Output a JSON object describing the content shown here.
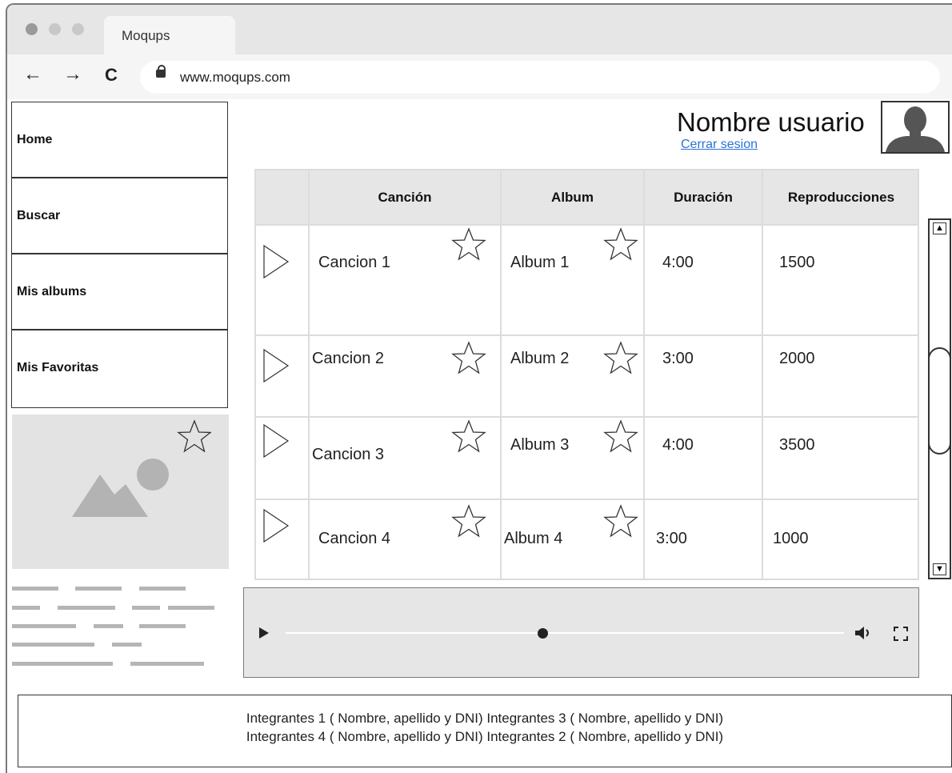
{
  "browser": {
    "tab_title": "Moqups",
    "url": "www.moqups.com",
    "back_icon": "←",
    "forward_icon": "→",
    "reload_icon": "C"
  },
  "sidebar": {
    "items": [
      {
        "label": "Home"
      },
      {
        "label": "Buscar"
      },
      {
        "label": "Mis albums"
      },
      {
        "label": "Mis Favoritas"
      }
    ]
  },
  "header": {
    "username": "Nombre usuario",
    "logout": "Cerrar sesion"
  },
  "table": {
    "columns": [
      "Canción",
      "Album",
      "Duración",
      "Reproducciones"
    ],
    "rows": [
      {
        "song": "Cancion 1",
        "album": "Album 1",
        "duration": "4:00",
        "plays": "1500"
      },
      {
        "song": "Cancion 2",
        "album": "Album 2",
        "duration": "3:00",
        "plays": "2000"
      },
      {
        "song": "Cancion 3",
        "album": "Album 3",
        "duration": "4:00",
        "plays": "3500"
      },
      {
        "song": "Cancion 4",
        "album": "Album 4",
        "duration": "3:00",
        "plays": "1000"
      }
    ]
  },
  "player": {
    "progress": 0.46
  },
  "footer": {
    "line1": "Integrantes 1 ( Nombre, apellido y DNI) Integrantes 3 ( Nombre, apellido y DNI)",
    "line2": "Integrantes 4 ( Nombre, apellido y DNI) Integrantes 2 ( Nombre, apellido y DNI)"
  },
  "colors": {
    "link": "#2a72d8",
    "chrome": "#e6e6e6",
    "table_header": "#e6e6e6"
  }
}
